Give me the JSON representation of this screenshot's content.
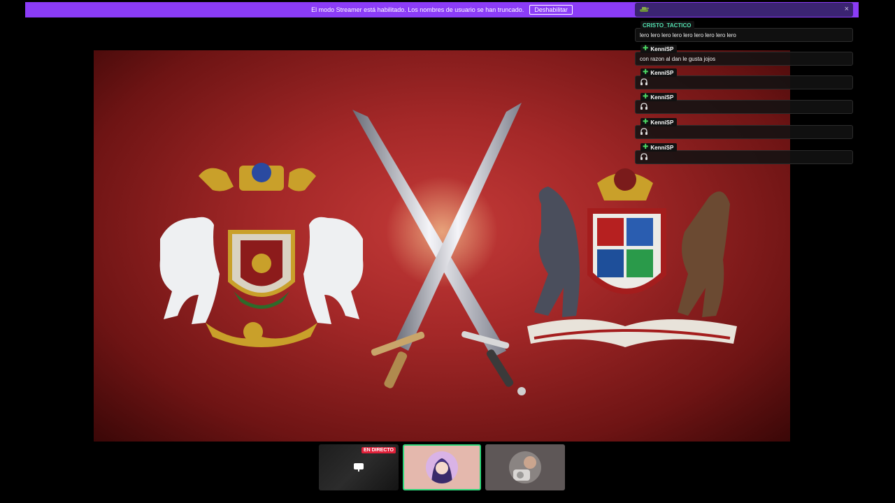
{
  "banner": {
    "text": "El modo Streamer está habilitado. Los nombres de usuario se han truncado.",
    "button_label": "Deshabilitar"
  },
  "chat": {
    "close_glyph": "×",
    "messages": [
      {
        "user": "CRISTO_TACTICO",
        "text": "lero lero lero lero lero lero lero lero lero",
        "badge": "none"
      },
      {
        "user": "KenniSP",
        "text": "con razon al dan le gusta jojos",
        "badge": "plus"
      },
      {
        "user": "KenniSP",
        "text": "",
        "badge": "plus",
        "icon": "headset-icon"
      },
      {
        "user": "KenniSP",
        "text": "",
        "badge": "plus",
        "icon": "headset-icon"
      },
      {
        "user": "KenniSP",
        "text": "",
        "badge": "plus",
        "icon": "headset-icon"
      },
      {
        "user": "KenniSP",
        "text": "",
        "badge": "plus",
        "icon": "headset-icon"
      }
    ],
    "top_user": "KenniSP"
  },
  "thumbnails": {
    "live_label": "EN DIRECTO"
  },
  "colors": {
    "banner": "#8b3cf7",
    "chat_top": "#3b2472",
    "live_badge": "#e0213a",
    "selected_border": "#2fd67a",
    "plus_badge": "#4cd964",
    "cristo_name": "#52e0b0"
  }
}
